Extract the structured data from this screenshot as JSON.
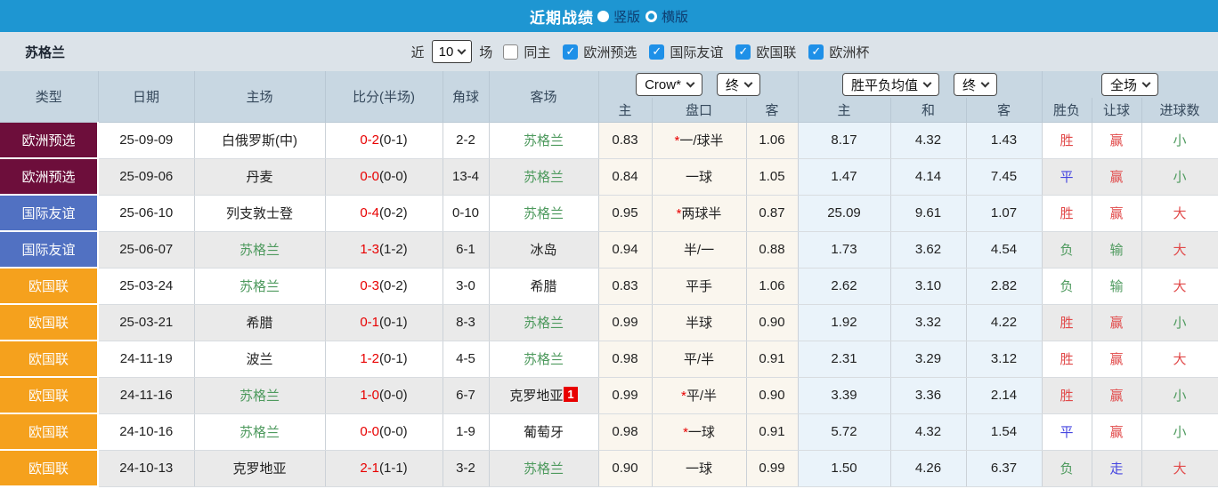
{
  "titlebar": {
    "title": "近期战绩",
    "radio_vertical": "竖版",
    "radio_horizontal": "横版"
  },
  "filterbar": {
    "team": "苏格兰",
    "near_label": "近",
    "near_value": "10",
    "games_label": "场",
    "same_home_label": "同主",
    "checkboxes": [
      {
        "label": "欧洲预选",
        "checked": true
      },
      {
        "label": "国际友谊",
        "checked": true
      },
      {
        "label": "欧国联",
        "checked": true
      },
      {
        "label": "欧洲杯",
        "checked": true
      }
    ]
  },
  "table": {
    "static_headers": [
      "类型",
      "日期",
      "主场",
      "比分(半场)",
      "角球",
      "客场"
    ],
    "dropdowns": {
      "odds_source": "Crow*",
      "odds_time": "终",
      "avg_source": "胜平负均值",
      "avg_time": "终",
      "scope": "全场"
    },
    "sub_headers": [
      "主",
      "盘口",
      "客",
      "主",
      "和",
      "客",
      "胜负",
      "让球",
      "进球数"
    ],
    "type_colors": {
      "欧洲预选": "#6D0E3B",
      "国际友谊": "#5171C2",
      "欧国联": "#F5A11D"
    },
    "rows": [
      {
        "type": "欧洲预选",
        "date": "25-09-09",
        "home": "白俄罗斯(中)",
        "home_is_scot": false,
        "score_ft": "0-2",
        "score_ht": "(0-1)",
        "corner": "2-2",
        "away": "苏格兰",
        "away_is_scot": true,
        "away_badge": "",
        "odds_home": "0.83",
        "handicap": "一/球半",
        "handicap_star": true,
        "odds_away": "1.06",
        "avg_home": "8.17",
        "avg_draw": "4.32",
        "avg_away": "1.43",
        "result": "胜",
        "result_color": "red",
        "hresult": "赢",
        "hresult_color": "red",
        "goals": "小",
        "goals_color": "green"
      },
      {
        "type": "欧洲预选",
        "date": "25-09-06",
        "home": "丹麦",
        "home_is_scot": false,
        "score_ft": "0-0",
        "score_ht": "(0-0)",
        "corner": "13-4",
        "away": "苏格兰",
        "away_is_scot": true,
        "away_badge": "",
        "odds_home": "0.84",
        "handicap": "一球",
        "handicap_star": false,
        "odds_away": "1.05",
        "avg_home": "1.47",
        "avg_draw": "4.14",
        "avg_away": "7.45",
        "result": "平",
        "result_color": "blue",
        "hresult": "赢",
        "hresult_color": "red",
        "goals": "小",
        "goals_color": "green"
      },
      {
        "type": "国际友谊",
        "date": "25-06-10",
        "home": "列支敦士登",
        "home_is_scot": false,
        "score_ft": "0-4",
        "score_ht": "(0-2)",
        "corner": "0-10",
        "away": "苏格兰",
        "away_is_scot": true,
        "away_badge": "",
        "odds_home": "0.95",
        "handicap": "两球半",
        "handicap_star": true,
        "odds_away": "0.87",
        "avg_home": "25.09",
        "avg_draw": "9.61",
        "avg_away": "1.07",
        "result": "胜",
        "result_color": "red",
        "hresult": "赢",
        "hresult_color": "red",
        "goals": "大",
        "goals_color": "red"
      },
      {
        "type": "国际友谊",
        "date": "25-06-07",
        "home": "苏格兰",
        "home_is_scot": true,
        "score_ft": "1-3",
        "score_ht": "(1-2)",
        "corner": "6-1",
        "away": "冰岛",
        "away_is_scot": false,
        "away_badge": "",
        "odds_home": "0.94",
        "handicap": "半/一",
        "handicap_star": false,
        "odds_away": "0.88",
        "avg_home": "1.73",
        "avg_draw": "3.62",
        "avg_away": "4.54",
        "result": "负",
        "result_color": "green",
        "hresult": "输",
        "hresult_color": "green",
        "goals": "大",
        "goals_color": "red"
      },
      {
        "type": "欧国联",
        "date": "25-03-24",
        "home": "苏格兰",
        "home_is_scot": true,
        "score_ft": "0-3",
        "score_ht": "(0-2)",
        "corner": "3-0",
        "away": "希腊",
        "away_is_scot": false,
        "away_badge": "",
        "odds_home": "0.83",
        "handicap": "平手",
        "handicap_star": false,
        "odds_away": "1.06",
        "avg_home": "2.62",
        "avg_draw": "3.10",
        "avg_away": "2.82",
        "result": "负",
        "result_color": "green",
        "hresult": "输",
        "hresult_color": "green",
        "goals": "大",
        "goals_color": "red"
      },
      {
        "type": "欧国联",
        "date": "25-03-21",
        "home": "希腊",
        "home_is_scot": false,
        "score_ft": "0-1",
        "score_ht": "(0-1)",
        "corner": "8-3",
        "away": "苏格兰",
        "away_is_scot": true,
        "away_badge": "",
        "odds_home": "0.99",
        "handicap": "半球",
        "handicap_star": false,
        "odds_away": "0.90",
        "avg_home": "1.92",
        "avg_draw": "3.32",
        "avg_away": "4.22",
        "result": "胜",
        "result_color": "red",
        "hresult": "赢",
        "hresult_color": "red",
        "goals": "小",
        "goals_color": "green"
      },
      {
        "type": "欧国联",
        "date": "24-11-19",
        "home": "波兰",
        "home_is_scot": false,
        "score_ft": "1-2",
        "score_ht": "(0-1)",
        "corner": "4-5",
        "away": "苏格兰",
        "away_is_scot": true,
        "away_badge": "",
        "odds_home": "0.98",
        "handicap": "平/半",
        "handicap_star": false,
        "odds_away": "0.91",
        "avg_home": "2.31",
        "avg_draw": "3.29",
        "avg_away": "3.12",
        "result": "胜",
        "result_color": "red",
        "hresult": "赢",
        "hresult_color": "red",
        "goals": "大",
        "goals_color": "red"
      },
      {
        "type": "欧国联",
        "date": "24-11-16",
        "home": "苏格兰",
        "home_is_scot": true,
        "score_ft": "1-0",
        "score_ht": "(0-0)",
        "corner": "6-7",
        "away": "克罗地亚",
        "away_is_scot": false,
        "away_badge": "1",
        "odds_home": "0.99",
        "handicap": "平/半",
        "handicap_star": true,
        "odds_away": "0.90",
        "avg_home": "3.39",
        "avg_draw": "3.36",
        "avg_away": "2.14",
        "result": "胜",
        "result_color": "red",
        "hresult": "赢",
        "hresult_color": "red",
        "goals": "小",
        "goals_color": "green"
      },
      {
        "type": "欧国联",
        "date": "24-10-16",
        "home": "苏格兰",
        "home_is_scot": true,
        "score_ft": "0-0",
        "score_ht": "(0-0)",
        "corner": "1-9",
        "away": "葡萄牙",
        "away_is_scot": false,
        "away_badge": "",
        "odds_home": "0.98",
        "handicap": "一球",
        "handicap_star": true,
        "odds_away": "0.91",
        "avg_home": "5.72",
        "avg_draw": "4.32",
        "avg_away": "1.54",
        "result": "平",
        "result_color": "blue",
        "hresult": "赢",
        "hresult_color": "red",
        "goals": "小",
        "goals_color": "green"
      },
      {
        "type": "欧国联",
        "date": "24-10-13",
        "home": "克罗地亚",
        "home_is_scot": false,
        "score_ft": "2-1",
        "score_ht": "(1-1)",
        "corner": "3-2",
        "away": "苏格兰",
        "away_is_scot": true,
        "away_badge": "",
        "odds_home": "0.90",
        "handicap": "一球",
        "handicap_star": false,
        "odds_away": "0.99",
        "avg_home": "1.50",
        "avg_draw": "4.26",
        "avg_away": "6.37",
        "result": "负",
        "result_color": "green",
        "hresult": "走",
        "hresult_color": "blue",
        "goals": "大",
        "goals_color": "red"
      }
    ]
  }
}
